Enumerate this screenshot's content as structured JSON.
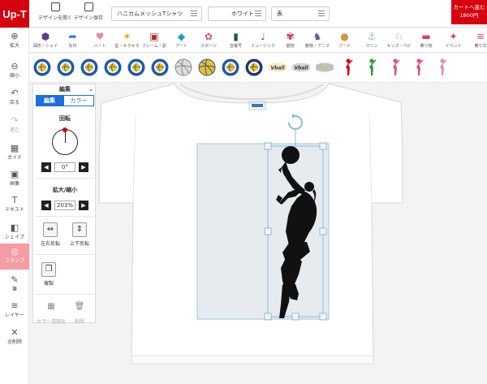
{
  "app": {
    "logo": "Up-T"
  },
  "toolbar": {
    "open_label": "デザインを開く",
    "save_label": "デザイン保存",
    "product": "ハニカムメッシュTシャツ",
    "color": "ホワイト",
    "side": "表",
    "cart_label": "カートへ進む",
    "cart_price": "1800円"
  },
  "categories": [
    {
      "label": "図形・シェイ",
      "icon": "hexagon-icon",
      "color": "#5b3b8c"
    },
    {
      "label": "矢印",
      "icon": "arrow-icon",
      "color": "#1e6fd9"
    },
    {
      "label": "ハート",
      "icon": "heart-icon",
      "color": "#e88aa0"
    },
    {
      "label": "星・キラキラ",
      "icon": "star-icon",
      "color": "#d9a400"
    },
    {
      "label": "フレーム・罫",
      "icon": "frame-icon",
      "color": "#b03030"
    },
    {
      "label": "アート",
      "icon": "art-icon",
      "color": "#19a0c8"
    },
    {
      "label": "スポーツ",
      "icon": "sports-icon",
      "color": "#d94f8c"
    },
    {
      "label": "音番号",
      "icon": "badge-icon",
      "color": "#1f5e2e"
    },
    {
      "label": "ミュージック",
      "icon": "mic-icon",
      "color": "#666666"
    },
    {
      "label": "植物",
      "icon": "rose-icon",
      "color": "#c0203a"
    },
    {
      "label": "動物・アニマ",
      "icon": "animal-icon",
      "color": "#6a4a9c"
    },
    {
      "label": "フード",
      "icon": "food-icon",
      "color": "#d4963c"
    },
    {
      "label": "マリン",
      "icon": "anchor-icon",
      "color": "#8fb8d8"
    },
    {
      "label": "キッズ・ベビ",
      "icon": "horse-icon",
      "color": "#b08050"
    },
    {
      "label": "乗り物",
      "icon": "vehicle-icon",
      "color": "#d94060"
    },
    {
      "label": "イベント",
      "icon": "event-icon",
      "color": "#d94060"
    },
    {
      "label": "乗り文",
      "icon": "text-icon",
      "color": "#d94060"
    }
  ],
  "stamps": [
    {
      "name": "volleyball-badge-icon",
      "color": "#1e5aa8",
      "accent": "#f0c020"
    },
    {
      "name": "volleyball-badge-icon",
      "color": "#1e5aa8",
      "accent": "#f0c020"
    },
    {
      "name": "volleyball-badge-icon",
      "color": "#1e5aa8",
      "accent": "#f0c020"
    },
    {
      "name": "volleyball-badge-icon",
      "color": "#1e5aa8",
      "accent": "#f0c020"
    },
    {
      "name": "volleyball-badge-icon",
      "color": "#1e5aa8",
      "accent": "#f0c020"
    },
    {
      "name": "volleyball-badge-icon",
      "color": "#1e5aa8",
      "accent": "#f0c020"
    },
    {
      "name": "volleyball-icon",
      "color": "#dddddd",
      "accent": "#888888"
    },
    {
      "name": "volleyball-icon",
      "color": "#f0c020",
      "accent": "#1e5aa8"
    },
    {
      "name": "volleyball-emblem-icon",
      "color": "#1e5aa8",
      "accent": "#f0c020"
    },
    {
      "name": "volleyball-emblem-icon",
      "color": "#1e3a6a",
      "accent": "#f0c020"
    },
    {
      "name": "volleyball-text-icon",
      "color": "#1e3a6a",
      "accent": "#f0c020"
    },
    {
      "name": "volleyball-text-icon",
      "color": "#333333",
      "accent": "#888888"
    },
    {
      "name": "volleyball-text-icon",
      "color": "#f0c020",
      "accent": "#1e5aa8"
    },
    {
      "name": "volleyball-player-icon",
      "color": "#d7000f",
      "accent": "#d7000f"
    },
    {
      "name": "volleyball-player-icon",
      "color": "#2a9a3a",
      "accent": "#2a9a3a"
    },
    {
      "name": "volleyball-player-icon",
      "color": "#d94f8c",
      "accent": "#d94f8c"
    },
    {
      "name": "volleyball-player-icon",
      "color": "#d94f8c",
      "accent": "#d94f8c"
    },
    {
      "name": "volleyball-player-icon",
      "color": "#e08ac0",
      "accent": "#e08ac0"
    }
  ],
  "sidebar": {
    "items": [
      {
        "label": "拡大",
        "icon": "zoom-in-icon"
      },
      {
        "label": "縮小",
        "icon": "zoom-out-icon"
      },
      {
        "label": "戻る",
        "icon": "undo-icon"
      },
      {
        "label": "進む",
        "icon": "redo-icon"
      },
      {
        "label": "ガイド",
        "icon": "guide-icon"
      },
      {
        "label": "画像",
        "icon": "image-icon"
      },
      {
        "label": "テキスト",
        "icon": "text-icon"
      },
      {
        "label": "シェイプ",
        "icon": "shape-icon"
      },
      {
        "label": "スタンプ",
        "icon": "stamp-icon"
      },
      {
        "label": "筆",
        "icon": "brush-icon"
      },
      {
        "label": "レイヤー",
        "icon": "layers-icon"
      },
      {
        "label": "全削除",
        "icon": "delete-all-icon"
      }
    ]
  },
  "panel": {
    "title": "編集",
    "tab_edit": "編集",
    "tab_color": "カラー",
    "rotate_label": "回転",
    "rotate_value": "0",
    "rotate_unit": "°",
    "scale_label": "拡大/縮小",
    "scale_value": "203",
    "scale_unit": "%",
    "flip_h": "左右反転",
    "flip_v": "上下反転",
    "duplicate": "複製",
    "transparent": "カラー透明化",
    "delete": "削除"
  }
}
